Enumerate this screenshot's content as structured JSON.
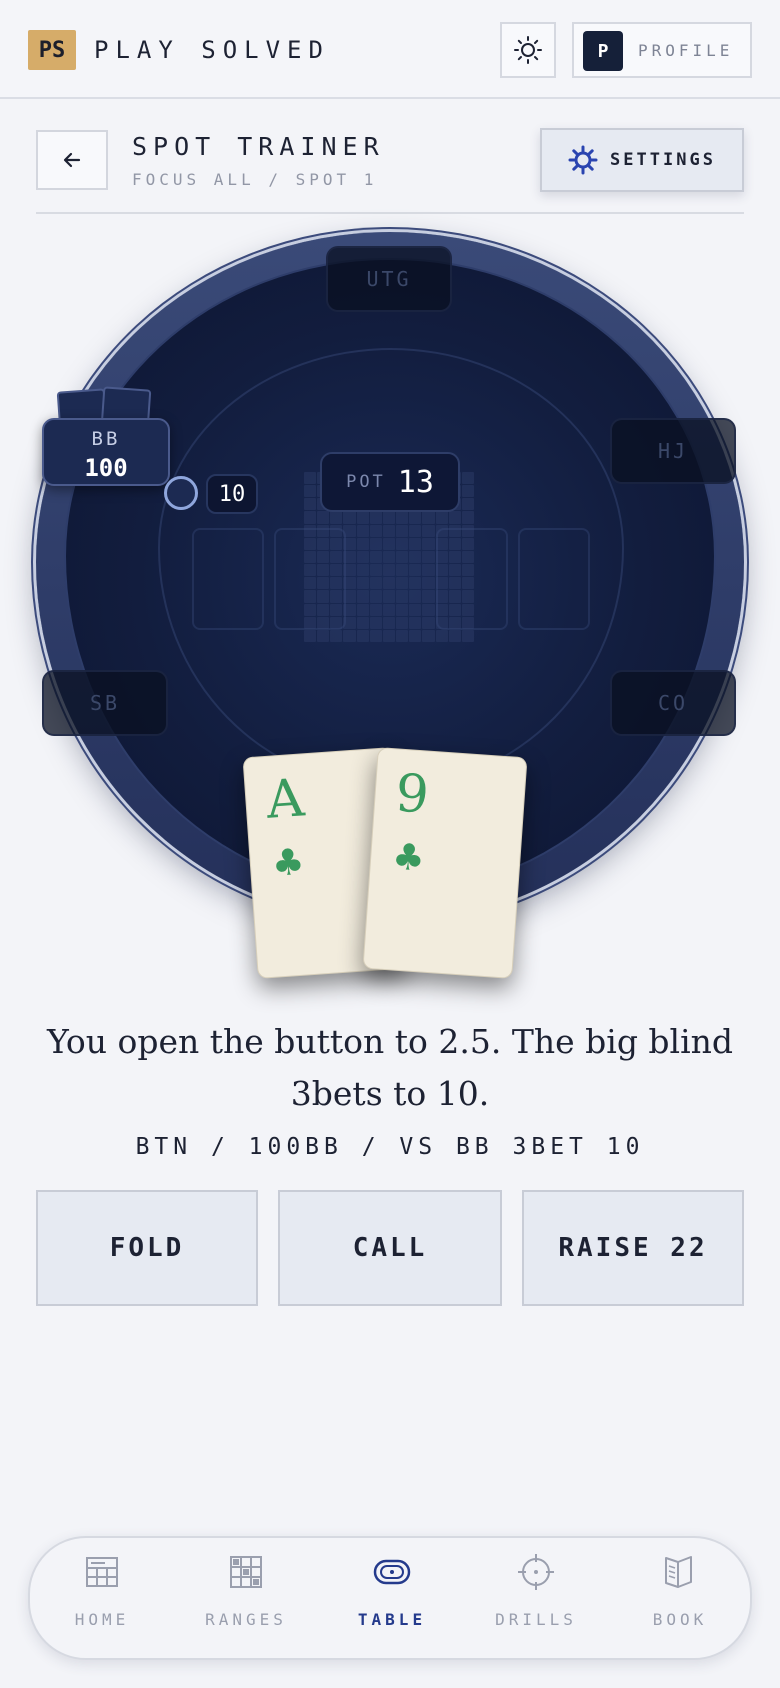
{
  "header": {
    "logo_text": "PS",
    "brand": "PLAY SOLVED",
    "theme_icon": "sun-icon",
    "profile_initial": "P",
    "profile_label": "PROFILE"
  },
  "page": {
    "title": "SPOT TRAINER",
    "subtitle": "FOCUS ALL / SPOT 1",
    "settings_label": "SETTINGS"
  },
  "table": {
    "seats": {
      "utg": "UTG",
      "hj": "HJ",
      "co": "CO",
      "sb": "SB",
      "bb": "BB"
    },
    "bb_stack": "100",
    "bb_bet": "10",
    "pot_label": "POT",
    "pot_value": "13",
    "hero_cards": [
      {
        "rank": "A",
        "suit": "♣"
      },
      {
        "rank": "9",
        "suit": "♣"
      }
    ]
  },
  "scenario": {
    "text": "You open the button to 2.5. The big blind 3bets to 10.",
    "meta": "BTN / 100BB / VS BB 3BET 10"
  },
  "actions": {
    "fold": "FOLD",
    "call": "CALL",
    "raise": "RAISE 22"
  },
  "nav": {
    "home": "HOME",
    "ranges": "RANGES",
    "table": "TABLE",
    "drills": "DRILLS",
    "book": "BOOK",
    "active": "table"
  },
  "colors": {
    "accent": "#243a8c",
    "logo_bg": "#d6ac69",
    "table_felt": "#121d3e",
    "card_suit": "#3a9a5e"
  }
}
